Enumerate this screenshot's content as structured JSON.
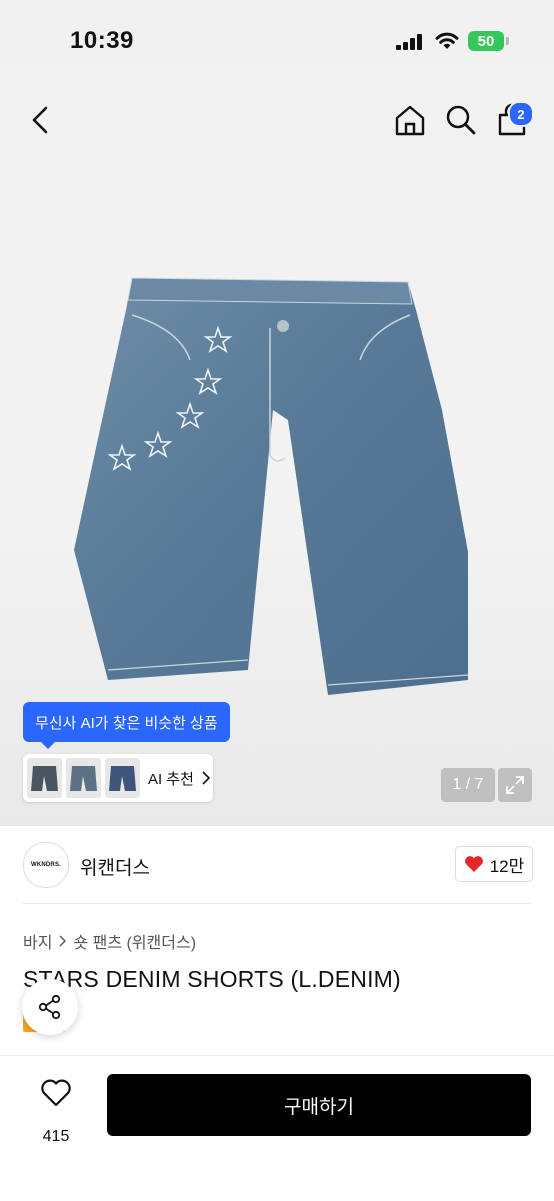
{
  "status_bar": {
    "time": "10:39",
    "battery": "50"
  },
  "nav": {
    "cart_count": "2"
  },
  "gallery": {
    "ai_tooltip": "무신사 AI가 찾은 비슷한 상품",
    "ai_recommend_label": "AI 추천",
    "page_counter": "1 / 7"
  },
  "brand": {
    "logo_text": "WKNDRS.",
    "name": "위캔더스",
    "likes": "12만"
  },
  "breadcrumb": [
    "바지",
    "숏 팬츠 (위캔더스)"
  ],
  "product": {
    "title": "STARS DENIM SHORTS (L.DENIM)",
    "badge": "세일"
  },
  "bottom_bar": {
    "wish_count": "415",
    "buy_label": "구매하기"
  },
  "colors": {
    "accent": "#2a66ff",
    "sale": "#f5a623",
    "buy": "#000000",
    "heart": "#e5262b"
  }
}
